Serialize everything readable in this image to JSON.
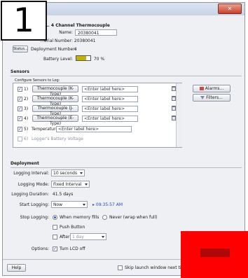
{
  "badge": "1",
  "window": {
    "title": "... 4 Channel Thermocouple",
    "close_label": "✕"
  },
  "device": {
    "name_label": "Name:",
    "name_value": "20380041",
    "serial_label": "...erial Number:",
    "serial_value": "20380041",
    "status_button": "Status...",
    "deployment_label": "Deployment Number:",
    "deployment_value": "4",
    "battery_label": "Battery Level:",
    "battery_value": "70 %",
    "battery_fraction": 0.7
  },
  "sensors": {
    "heading": "Sensors",
    "group_label": "Configure Sensors to Log:",
    "alarms_button": "Alarms...",
    "filters_button": "Filters...",
    "rows": [
      {
        "num": "1)",
        "checked": true,
        "type": "Thermocouple (K-Type)",
        "placeholder": "<Enter label here>"
      },
      {
        "num": "2)",
        "checked": true,
        "type": "Thermocouple (K-Type)",
        "placeholder": "<Enter label here>"
      },
      {
        "num": "3)",
        "checked": true,
        "type": "Thermocouple (J-Type)",
        "placeholder": "<Enter label here>"
      },
      {
        "num": "4)",
        "checked": true,
        "type": "Thermocouple (E-Type)",
        "placeholder": "<Enter label here>"
      }
    ],
    "row5": {
      "num": "5)",
      "label": "Temperature",
      "placeholder": "<Enter label here>"
    },
    "row6": {
      "num": "6)",
      "label": "Logger's Battery Voltage"
    }
  },
  "deployment": {
    "heading": "Deployment",
    "interval_label": "Logging Interval:",
    "interval_value": "10 seconds",
    "mode_label": "Logging Mode:",
    "mode_value": "Fixed Interval",
    "duration_label": "Logging Duration:",
    "duration_value": "41.5 days",
    "start_label": "Start Logging:",
    "start_value": "Now",
    "start_time": "09:35:57 AM",
    "stop_label": "Stop Logging:",
    "stop_opt1": "When memory fills",
    "stop_opt2": "Never (wrap when full)",
    "push_button_label": "Push Button",
    "after_label": "After",
    "after_value": "1 day",
    "options_label": "Options:",
    "lcd_label": "Turn LCD off"
  },
  "footer": {
    "help_button": "Help",
    "skip_label": "Skip launch window next tim"
  },
  "colors": {
    "red_overlay": "#ff0000"
  }
}
